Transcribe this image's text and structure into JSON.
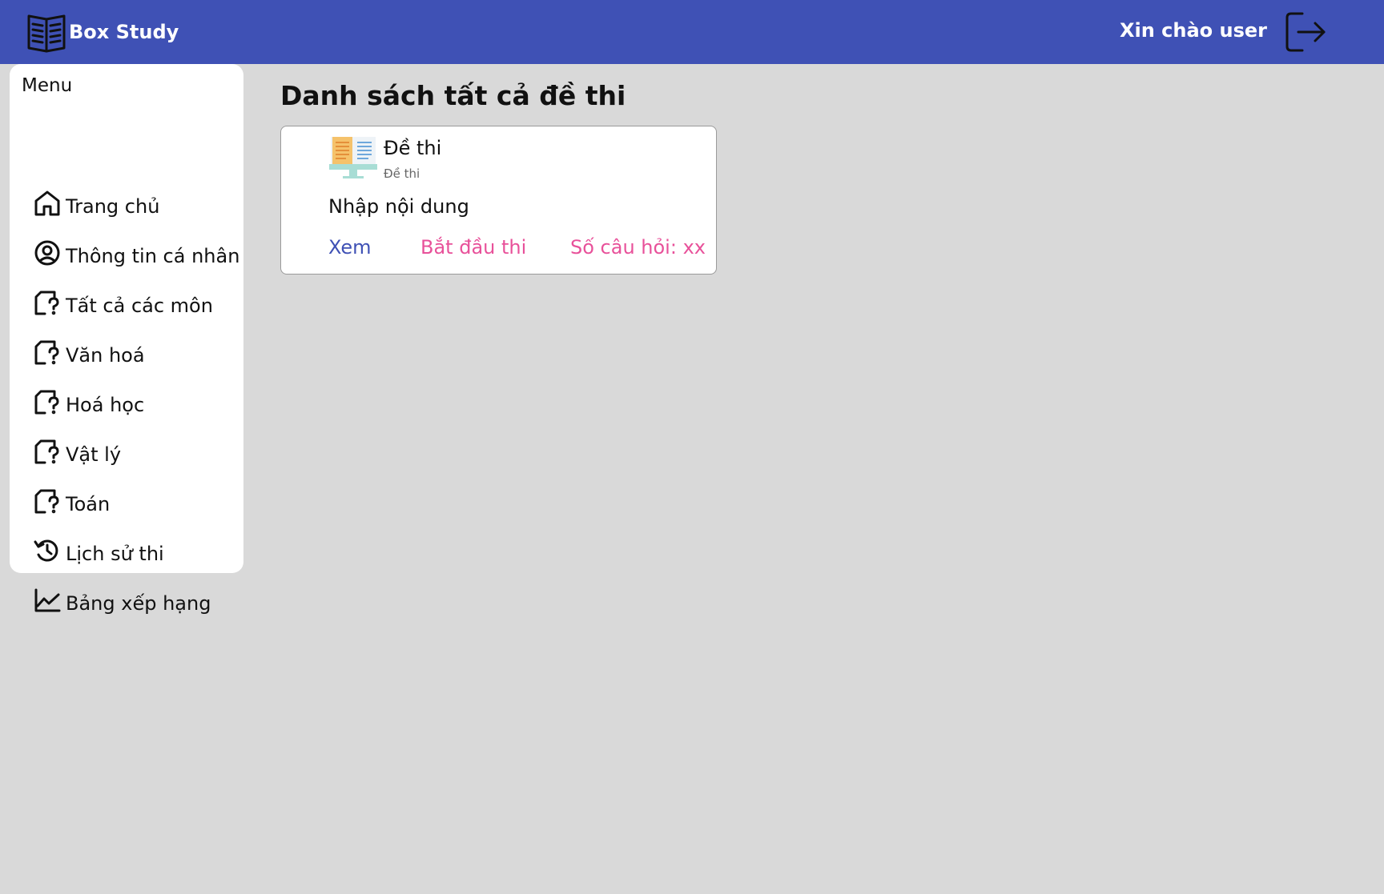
{
  "header": {
    "brand_name": "Box Study",
    "brand_icon": "open-book-icon",
    "greeting": "Xin chào user",
    "logout_icon": "logout-icon",
    "color": "#3f51b5"
  },
  "sidebar": {
    "title": "Menu",
    "items": [
      {
        "label": "Trang chủ",
        "icon": "home-icon"
      },
      {
        "label": "Thông tin cá nhân",
        "icon": "user-circle-icon"
      },
      {
        "label": "Tất cả các môn",
        "icon": "file-question-icon"
      },
      {
        "label": "Văn hoá",
        "icon": "file-question-icon"
      },
      {
        "label": "Hoá học",
        "icon": "file-question-icon"
      },
      {
        "label": "Vật lý",
        "icon": "file-question-icon"
      },
      {
        "label": "Toán",
        "icon": "file-question-icon"
      },
      {
        "label": "Lịch sử thi",
        "icon": "history-icon"
      },
      {
        "label": "Bảng xếp hạng",
        "icon": "chart-line-icon"
      }
    ]
  },
  "main": {
    "title": "Danh sách tất cả đề thi",
    "exams": [
      {
        "title": "Đề thi",
        "subtitle": "Đề thi",
        "description": "Nhập nội dung",
        "view_label": "Xem",
        "start_label": "Bắt đầu thi",
        "question_count": "Số câu hỏi: xx",
        "thumbnail_icon": "monitor-document-icon"
      }
    ]
  },
  "colors": {
    "background": "#d9d9d9",
    "link_view": "#3f51b5",
    "link_accent": "#e8519a"
  }
}
